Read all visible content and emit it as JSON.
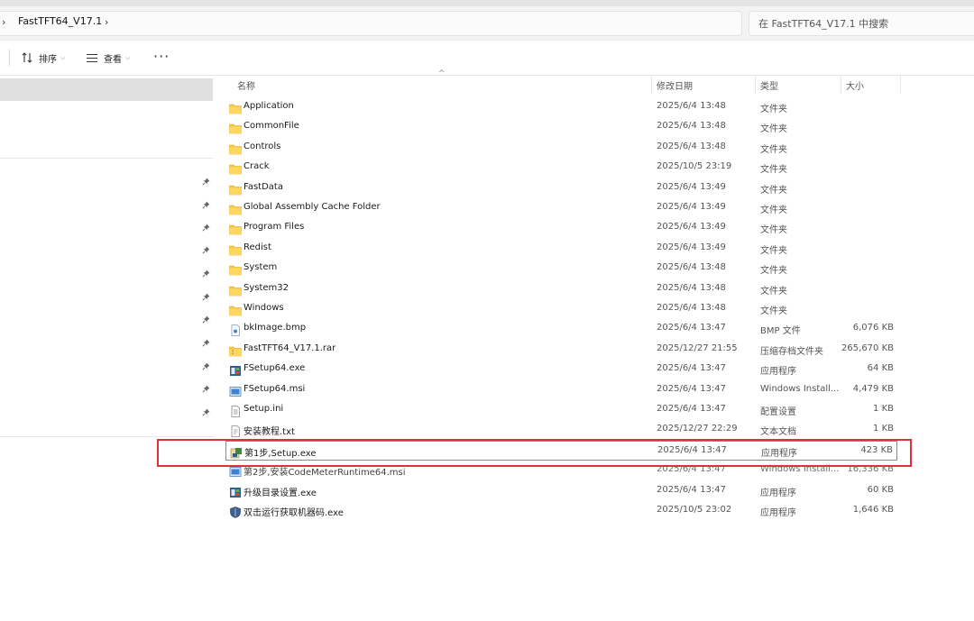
{
  "address": {
    "path": "FastTFT64_V17.1"
  },
  "search": {
    "placeholder": "在 FastTFT64_V17.1 中搜索"
  },
  "toolbar": {
    "sort_label": "排序",
    "view_label": "查看",
    "more_label": "···"
  },
  "columns": {
    "name": "名称",
    "date": "修改日期",
    "type": "类型",
    "size": "大小"
  },
  "files": [
    {
      "name": "Application",
      "date": "2025/6/4 13:48",
      "type": "文件夹",
      "size": "",
      "icon": "folder-icon"
    },
    {
      "name": "CommonFile",
      "date": "2025/6/4 13:48",
      "type": "文件夹",
      "size": "",
      "icon": "folder-icon"
    },
    {
      "name": "Controls",
      "date": "2025/6/4 13:48",
      "type": "文件夹",
      "size": "",
      "icon": "folder-icon"
    },
    {
      "name": "Crack",
      "date": "2025/10/5 23:19",
      "type": "文件夹",
      "size": "",
      "icon": "folder-icon"
    },
    {
      "name": "FastData",
      "date": "2025/6/4 13:49",
      "type": "文件夹",
      "size": "",
      "icon": "folder-icon"
    },
    {
      "name": "Global Assembly Cache Folder",
      "date": "2025/6/4 13:49",
      "type": "文件夹",
      "size": "",
      "icon": "folder-icon"
    },
    {
      "name": "Program Files",
      "date": "2025/6/4 13:49",
      "type": "文件夹",
      "size": "",
      "icon": "folder-icon"
    },
    {
      "name": "Redist",
      "date": "2025/6/4 13:49",
      "type": "文件夹",
      "size": "",
      "icon": "folder-icon"
    },
    {
      "name": "System",
      "date": "2025/6/4 13:48",
      "type": "文件夹",
      "size": "",
      "icon": "folder-icon"
    },
    {
      "name": "System32",
      "date": "2025/6/4 13:48",
      "type": "文件夹",
      "size": "",
      "icon": "folder-icon"
    },
    {
      "name": "Windows",
      "date": "2025/6/4 13:48",
      "type": "文件夹",
      "size": "",
      "icon": "folder-icon"
    },
    {
      "name": "bkImage.bmp",
      "date": "2025/6/4 13:47",
      "type": "BMP 文件",
      "size": "6,076 KB",
      "icon": "bmp-file-icon"
    },
    {
      "name": "FastTFT64_V17.1.rar",
      "date": "2025/12/27 21:55",
      "type": "压缩存档文件夹",
      "size": "265,670 KB",
      "icon": "zip-folder-icon"
    },
    {
      "name": "FSetup64.exe",
      "date": "2025/6/4 13:47",
      "type": "应用程序",
      "size": "64 KB",
      "icon": "exe-icon"
    },
    {
      "name": "FSetup64.msi",
      "date": "2025/6/4 13:47",
      "type": "Windows Install...",
      "size": "4,479 KB",
      "icon": "msi-icon"
    },
    {
      "name": "Setup.ini",
      "date": "2025/6/4 13:47",
      "type": "配置设置",
      "size": "1 KB",
      "icon": "ini-file-icon"
    },
    {
      "name": "安装教程.txt",
      "date": "2025/12/27 22:29",
      "type": "文本文档",
      "size": "1 KB",
      "icon": "text-file-icon"
    },
    {
      "name": "第1步,Setup.exe",
      "date": "2025/6/4 13:47",
      "type": "应用程序",
      "size": "423 KB",
      "icon": "setup-exe-icon"
    },
    {
      "name": "第2步,安装CodeMeterRuntime64.msi",
      "date": "2025/6/4 13:47",
      "type": "Windows Install...",
      "size": "16,336 KB",
      "icon": "msi-icon"
    },
    {
      "name": "升级目录设置.exe",
      "date": "2025/6/4 13:47",
      "type": "应用程序",
      "size": "60 KB",
      "icon": "exe-icon"
    },
    {
      "name": "双击运行获取机器码.exe",
      "date": "2025/10/5 23:02",
      "type": "应用程序",
      "size": "1,646 KB",
      "icon": "shield-exe-icon"
    }
  ]
}
